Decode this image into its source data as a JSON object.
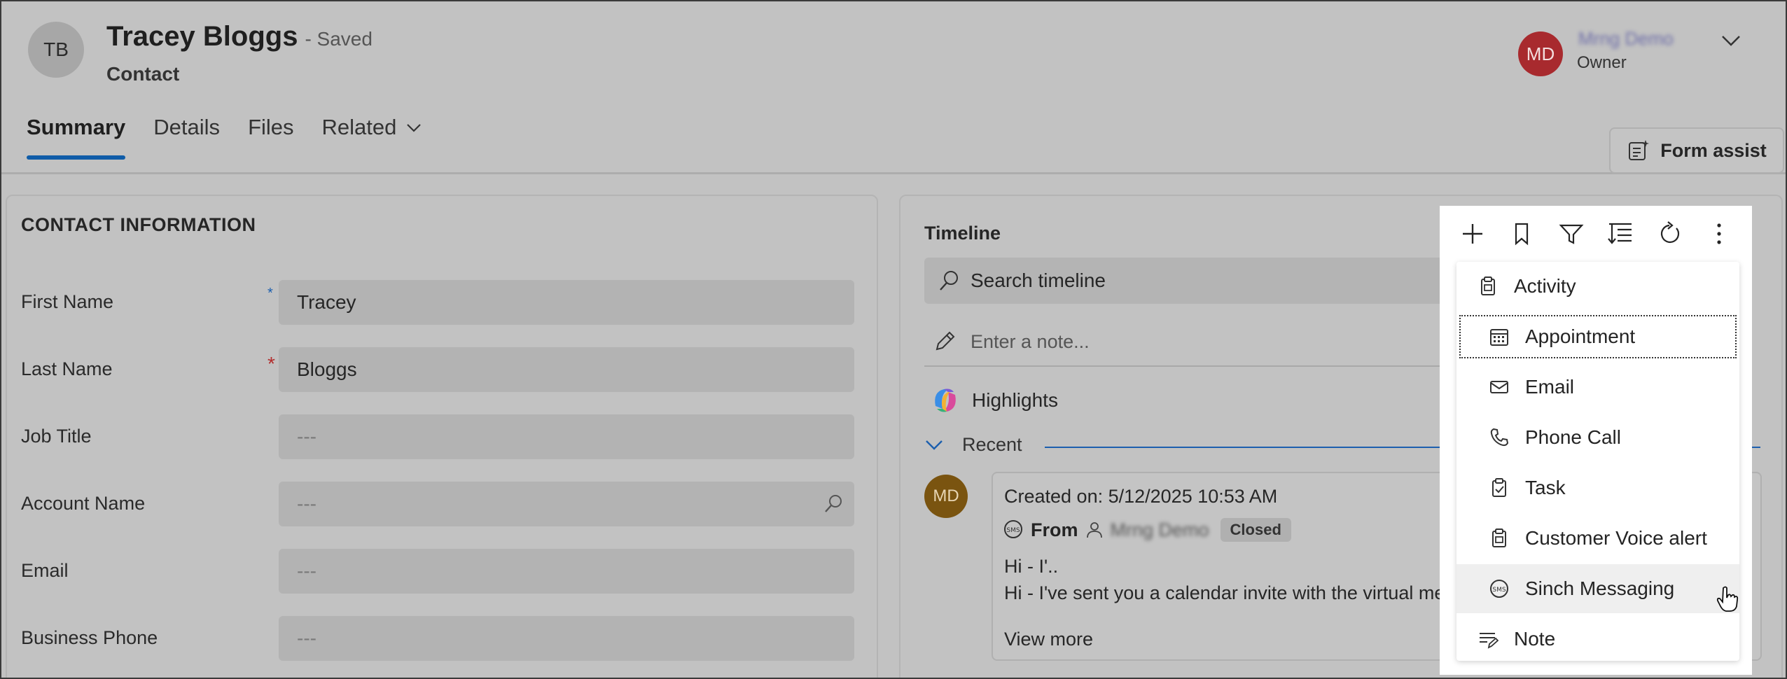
{
  "record": {
    "initials": "TB",
    "name": "Tracey Bloggs",
    "status": "- Saved",
    "entity": "Contact"
  },
  "owner": {
    "initials": "MD",
    "name": "Mrng Demo",
    "role": "Owner"
  },
  "tabs": [
    {
      "label": "Summary"
    },
    {
      "label": "Details"
    },
    {
      "label": "Files"
    },
    {
      "label": "Related"
    }
  ],
  "form_assist": {
    "label": "Form assist"
  },
  "contact_section": {
    "title": "CONTACT INFORMATION",
    "fields": [
      {
        "label": "First Name",
        "value": "Tracey",
        "required": "*"
      },
      {
        "label": "Last Name",
        "value": "Bloggs",
        "required": "*"
      },
      {
        "label": "Job Title",
        "value": "---"
      },
      {
        "label": "Account Name",
        "value": "---"
      },
      {
        "label": "Email",
        "value": "---"
      },
      {
        "label": "Business Phone",
        "value": "---"
      }
    ]
  },
  "timeline": {
    "title": "Timeline",
    "search_placeholder": "Search timeline",
    "note_placeholder": "Enter a note...",
    "highlights_label": "Highlights",
    "recent_label": "Recent",
    "activity": {
      "avatar": "MD",
      "created": "Created on: 5/12/2025 10:53 AM",
      "from_label": "From",
      "from_name": "Mrng Demo",
      "status": "Closed",
      "line1": "Hi - I'..",
      "line2": "Hi - I've sent you a calendar invite with the virtual me",
      "view_more": "View more"
    }
  },
  "toolbar": {
    "icons": [
      "plus-icon",
      "bookmark-icon",
      "filter-icon",
      "sort-icon",
      "refresh-icon",
      "more-vertical-icon"
    ]
  },
  "new_activity_menu": {
    "items": [
      {
        "label": "Activity",
        "icon": "activity-clipboard-icon"
      },
      {
        "label": "Appointment",
        "icon": "calendar-icon"
      },
      {
        "label": "Email",
        "icon": "mail-icon"
      },
      {
        "label": "Phone Call",
        "icon": "phone-icon"
      },
      {
        "label": "Task",
        "icon": "task-clipboard-icon"
      },
      {
        "label": "Customer Voice alert",
        "icon": "clipboard-alert-icon"
      },
      {
        "label": "Sinch Messaging",
        "icon": "sms-icon"
      },
      {
        "label": "Note",
        "icon": "note-icon"
      }
    ]
  },
  "colors": {
    "accent": "#0f5ca8",
    "owner_avatar": "#a82a2e",
    "activity_avatar": "#7a5410",
    "required_red": "#b22d2d",
    "recommended_blue": "#1c5fae"
  }
}
